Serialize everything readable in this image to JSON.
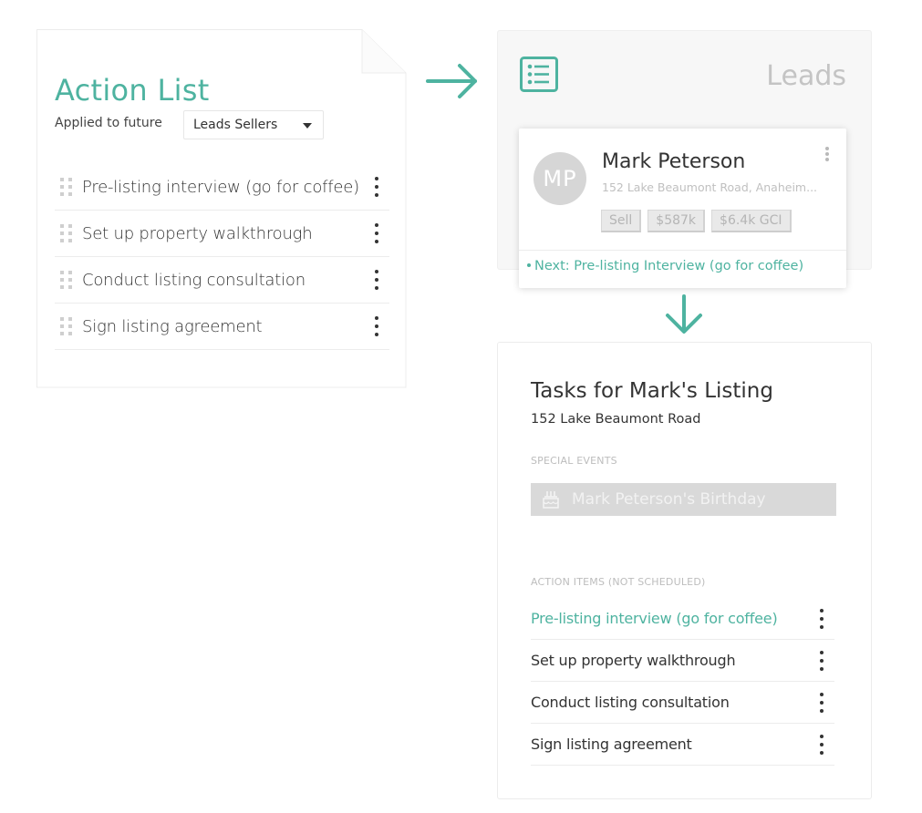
{
  "colors": {
    "accent": "#4eb3a0",
    "muted_text": "#c0c0c0",
    "tag_bg": "#e9e9e9",
    "event_bg": "#d9d9d9"
  },
  "action_list": {
    "title": "Action List",
    "applied_label": "Applied to future",
    "select": {
      "value": "Leads Sellers",
      "icon": "caret-down-icon"
    },
    "items": [
      {
        "label": "Pre-listing interview (go for coffee)",
        "handle_icon": "drag-handle-icon",
        "menu_icon": "kebab-menu-icon"
      },
      {
        "label": "Set up property walkthrough",
        "handle_icon": "drag-handle-icon",
        "menu_icon": "kebab-menu-icon"
      },
      {
        "label": "Conduct listing consultation",
        "handle_icon": "drag-handle-icon",
        "menu_icon": "kebab-menu-icon"
      },
      {
        "label": "Sign listing agreement",
        "handle_icon": "drag-handle-icon",
        "menu_icon": "kebab-menu-icon"
      }
    ]
  },
  "flow_arrows": [
    "arrow-right-icon",
    "arrow-down-icon"
  ],
  "leads": {
    "title": "Leads",
    "icon": "list-icon",
    "card": {
      "initials": "MP",
      "name": "Mark Peterson",
      "address": "152 Lake Beaumont Road, Anaheim...",
      "tags": [
        "Sell",
        "$587k",
        "$6.4k GCI"
      ],
      "next_action": "Next: Pre-listing Interview (go for coffee)",
      "menu_icon": "kebab-menu-icon"
    }
  },
  "tasks": {
    "title": "Tasks for Mark's Listing",
    "subtitle": "152 Lake Beaumont Road",
    "special_events_label": "SPECIAL EVENTS",
    "event": {
      "icon": "birthday-cake-icon",
      "label": "Mark Peterson's Birthday"
    },
    "action_items_label": "ACTION ITEMS (NOT SCHEDULED)",
    "items": [
      {
        "label": "Pre-listing interview (go for coffee)",
        "active": true
      },
      {
        "label": "Set up property walkthrough",
        "active": false
      },
      {
        "label": "Conduct listing consultation",
        "active": false
      },
      {
        "label": "Sign listing agreement",
        "active": false
      }
    ]
  }
}
